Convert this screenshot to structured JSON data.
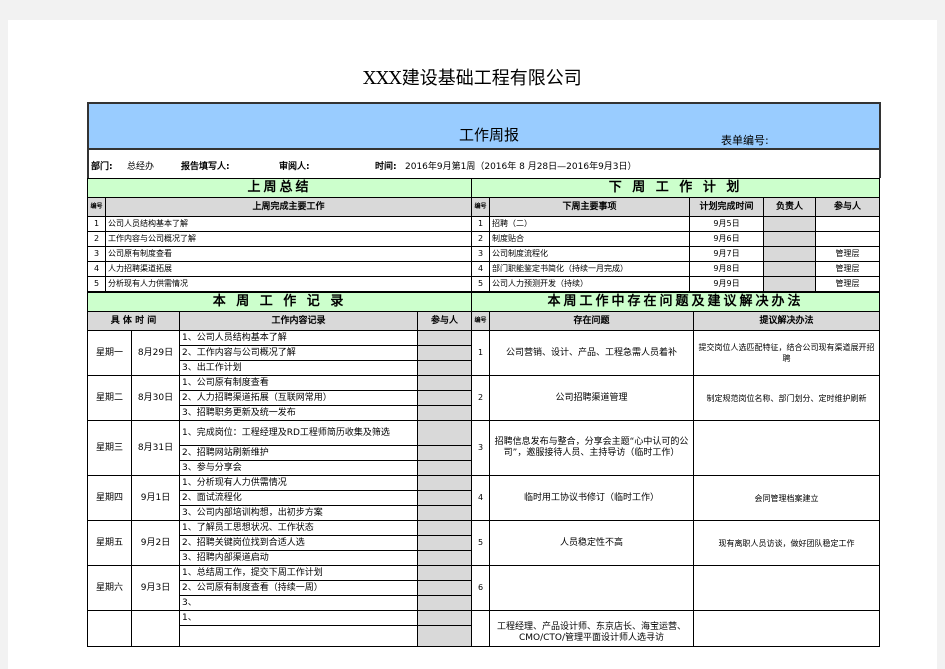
{
  "company": "XXX建设基础工程有限公司",
  "title": "工作周报",
  "form_no_label": "表单编号:",
  "info": {
    "dept_label": "部门:",
    "dept": "总经办",
    "filler_label": "报告填写人:",
    "reviewer_label": "审阅人:",
    "time_label": "时间:",
    "time": "2016年9月第1周（2016年 8 月28日—2016年9月3日）"
  },
  "last_week": {
    "title": "上周总结",
    "col_no": "编号",
    "col_work": "上周完成主要工作",
    "items": [
      {
        "no": "1",
        "text": "公司人员结构基本了解"
      },
      {
        "no": "2",
        "text": "工作内容与公司概况了解"
      },
      {
        "no": "3",
        "text": "公司原有制度查看"
      },
      {
        "no": "4",
        "text": "人力招聘渠道拓展"
      },
      {
        "no": "5",
        "text": "分析现有人力供需情况"
      }
    ]
  },
  "next_week": {
    "title": "下 周 工 作 计 划",
    "col_no": "编号",
    "col_task": "下周主要事项",
    "col_date": "计划完成时间",
    "col_owner": "负责人",
    "col_part": "参与人",
    "items": [
      {
        "no": "1",
        "task": "招聘（二）",
        "date": "9月5日",
        "part": ""
      },
      {
        "no": "2",
        "task": "制度贴合",
        "date": "9月6日",
        "part": ""
      },
      {
        "no": "3",
        "task": "公司制度流程化",
        "date": "9月7日",
        "part": "管理层"
      },
      {
        "no": "4",
        "task": "部门职能鉴定书简化（持续一月完成）",
        "date": "9月8日",
        "part": "管理层"
      },
      {
        "no": "5",
        "task": "公司人力预测开发（持续）",
        "date": "9月9日",
        "part": "管理层"
      }
    ]
  },
  "this_week": {
    "title": "本 周 工 作 记 录",
    "col_time": "具 体 时 间",
    "col_content": "工作内容记录",
    "col_part": "参与人",
    "days": [
      {
        "day": "星期一",
        "date": "8月29日",
        "lines": [
          "1、公司人员结构基本了解",
          "2、工作内容与公司概况了解",
          "3、出工作计划"
        ]
      },
      {
        "day": "星期二",
        "date": "8月30日",
        "lines": [
          "1、公司原有制度查看",
          "2、人力招聘渠道拓展（互联网常用）",
          "3、招聘职务更新及统一发布"
        ]
      },
      {
        "day": "星期三",
        "date": "8月31日",
        "lines": [
          "1、完成岗位：工程经理及RD工程师简历收集及筛选",
          "2、招聘网站刷新维护",
          "3、参与分享会"
        ]
      },
      {
        "day": "星期四",
        "date": "9月1日",
        "lines": [
          "1、分析现有人力供需情况",
          "2、面试流程化",
          "3、公司内部培训构想，出初步方案"
        ]
      },
      {
        "day": "星期五",
        "date": "9月2日",
        "lines": [
          "1、了解员工思想状况、工作状态",
          "2、招聘关键岗位找到合适人选",
          "3、招聘内部渠道启动"
        ]
      },
      {
        "day": "星期六",
        "date": "9月3日",
        "lines": [
          "1、总结周工作，提交下周工作计划",
          "2、公司原有制度查看（持续一周）",
          "3、"
        ]
      },
      {
        "day": "",
        "date": "",
        "lines": [
          "1、"
        ]
      }
    ]
  },
  "issues": {
    "title": "本周工作中存在问题及建议解决办法",
    "col_no": "编号",
    "col_issue": "存在问题",
    "col_solution": "提议解决办法",
    "items": [
      {
        "no": "1",
        "issue": "公司营销、设计、产品、工程急需人员着补",
        "solution": "提交岗位人选匹配特征，结合公司现有渠道展开招聘"
      },
      {
        "no": "2",
        "issue": "公司招聘渠道管理",
        "solution": "制定规范岗位名称、部门划分、定时维护刷新"
      },
      {
        "no": "3",
        "issue": "招聘信息发布与整合，分享会主题“心中认可的公司”，邀服接待人员、主持导访（临时工作）",
        "solution": ""
      },
      {
        "no": "4",
        "issue": "临时用工协议书修订（临时工作）",
        "solution": "会同管理档案建立"
      },
      {
        "no": "5",
        "issue": "人员稳定性不高",
        "solution": "现有离职人员访谈，做好团队稳定工作"
      },
      {
        "no": "6",
        "issue": "",
        "solution": ""
      },
      {
        "no": "",
        "issue": "工程经理、产品设计师、东京店长、海宝运营、CMO/CTO/管理平面设计师人选寻访",
        "solution": ""
      }
    ]
  }
}
